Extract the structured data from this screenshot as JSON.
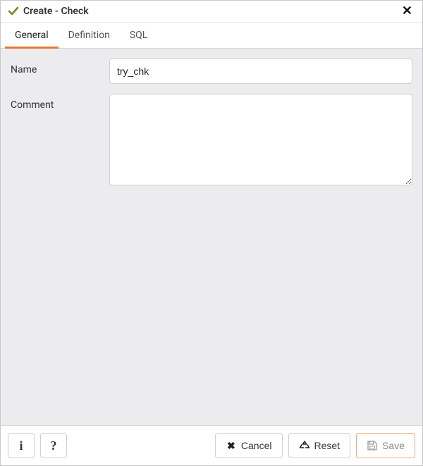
{
  "header": {
    "title": "Create - Check"
  },
  "tabs": [
    {
      "label": "General",
      "active": true
    },
    {
      "label": "Definition",
      "active": false
    },
    {
      "label": "SQL",
      "active": false
    }
  ],
  "form": {
    "name_label": "Name",
    "name_value": "try_chk",
    "comment_label": "Comment",
    "comment_value": ""
  },
  "footer": {
    "info_label": "i",
    "help_label": "?",
    "cancel_label": "Cancel",
    "reset_label": "Reset",
    "save_label": "Save"
  },
  "colors": {
    "accent": "#e9762f"
  }
}
